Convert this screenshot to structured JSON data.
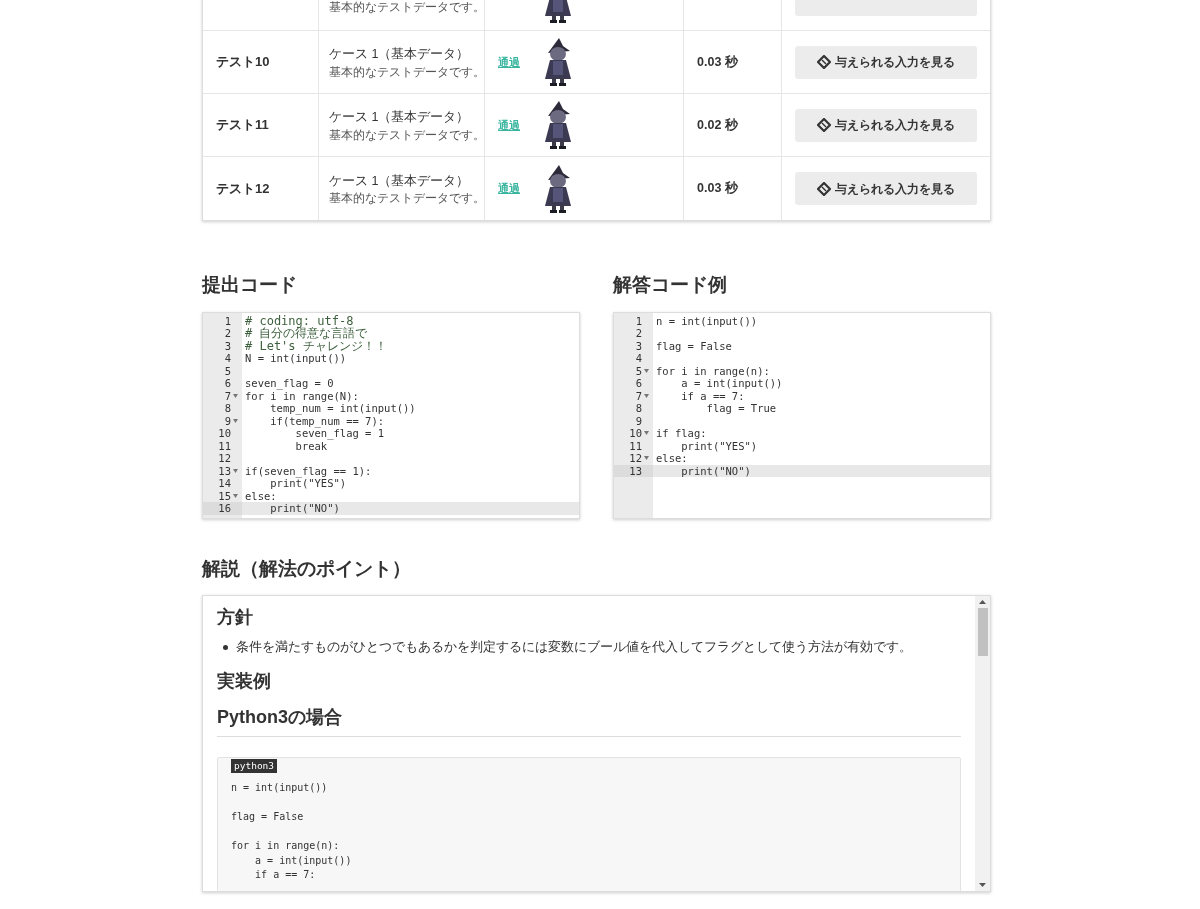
{
  "test_table": {
    "rows": [
      {
        "description": "基本的なテストデータです。"
      },
      {
        "name": "テスト10",
        "case": "ケース 1（基本データ）",
        "description": "基本的なテストデータです。",
        "result": "通過",
        "time": "0.03 秒",
        "button": "与えられる入力を見る"
      },
      {
        "name": "テスト11",
        "case": "ケース 1（基本データ）",
        "description": "基本的なテストデータです。",
        "result": "通過",
        "time": "0.02 秒",
        "button": "与えられる入力を見る"
      },
      {
        "name": "テスト12",
        "case": "ケース 1（基本データ）",
        "description": "基本的なテストデータです。",
        "result": "通過",
        "time": "0.03 秒",
        "button": "与えられる入力を見る"
      }
    ]
  },
  "editors": [
    {
      "title": "提出コード",
      "lines": [
        {
          "no": "1",
          "text": "# coding: utf-8",
          "kind": "comment",
          "fold": false,
          "active": false
        },
        {
          "no": "2",
          "text": "# 自分の得意な言語で",
          "kind": "comment",
          "fold": false,
          "active": false
        },
        {
          "no": "3",
          "text": "# Let's チャレンジ！！",
          "kind": "comment",
          "fold": false,
          "active": false
        },
        {
          "no": "4",
          "text": "N = int(input())",
          "kind": "code",
          "fold": false,
          "active": false
        },
        {
          "no": "5",
          "kind": "code",
          "fold": false,
          "active": false
        },
        {
          "no": "6",
          "text": "seven_flag = 0",
          "kind": "code",
          "fold": false,
          "active": false
        },
        {
          "no": "7",
          "text": "for i in range(N):",
          "kind": "code",
          "fold": true,
          "active": false
        },
        {
          "no": "8",
          "text": "    temp_num = int(input())",
          "kind": "code",
          "fold": false,
          "active": false
        },
        {
          "no": "9",
          "text": "    if(temp_num == 7):",
          "kind": "code",
          "fold": true,
          "active": false
        },
        {
          "no": "10",
          "text": "        seven_flag = 1",
          "kind": "code",
          "fold": false,
          "active": false
        },
        {
          "no": "11",
          "text": "        break",
          "kind": "code",
          "fold": false,
          "active": false
        },
        {
          "no": "12",
          "kind": "code",
          "fold": false,
          "active": false
        },
        {
          "no": "13",
          "text": "if(seven_flag == 1):",
          "kind": "code",
          "fold": true,
          "active": false
        },
        {
          "no": "14",
          "text": "    print(\"YES\")",
          "kind": "code",
          "fold": false,
          "active": false
        },
        {
          "no": "15",
          "text": "else:",
          "kind": "code",
          "fold": true,
          "active": false
        },
        {
          "no": "16",
          "text": "    print(\"NO\")",
          "kind": "code",
          "fold": false,
          "active": true
        }
      ]
    },
    {
      "title": "解答コード例",
      "lines": [
        {
          "no": "1",
          "text": "n = int(input())",
          "kind": "code",
          "fold": false,
          "active": false
        },
        {
          "no": "2",
          "kind": "code",
          "fold": false,
          "active": false
        },
        {
          "no": "3",
          "text": "flag = False",
          "kind": "code",
          "fold": false,
          "active": false
        },
        {
          "no": "4",
          "kind": "code",
          "fold": false,
          "active": false
        },
        {
          "no": "5",
          "text": "for i in range(n):",
          "kind": "code",
          "fold": true,
          "active": false
        },
        {
          "no": "6",
          "text": "    a = int(input())",
          "kind": "code",
          "fold": false,
          "active": false
        },
        {
          "no": "7",
          "text": "    if a == 7:",
          "kind": "code",
          "fold": true,
          "active": false
        },
        {
          "no": "8",
          "text": "        flag = True",
          "kind": "code",
          "fold": false,
          "active": false
        },
        {
          "no": "9",
          "kind": "code",
          "fold": false,
          "active": false
        },
        {
          "no": "10",
          "text": "if flag:",
          "kind": "code",
          "fold": true,
          "active": false
        },
        {
          "no": "11",
          "text": "    print(\"YES\")",
          "kind": "code",
          "fold": false,
          "active": false
        },
        {
          "no": "12",
          "text": "else:",
          "kind": "code",
          "fold": true,
          "active": false
        },
        {
          "no": "13",
          "text": "    print(\"NO\")",
          "kind": "code",
          "fold": false,
          "active": true
        }
      ]
    }
  ],
  "explanation": {
    "title": "解説（解法のポイント）",
    "heading_1": "方針",
    "bullets": [
      "条件を満たすものがひとつでもあるかを判定するには変数にブール値を代入してフラグとして使う方法が有効です。"
    ],
    "heading_2": "実装例",
    "heading_3": "Python3の場合",
    "code_label": "python3",
    "code_lines": [
      {
        "kind": "code",
        "text": "n = int(input())"
      },
      {
        "kind": "blank"
      },
      {
        "kind": "code",
        "text": "flag = False"
      },
      {
        "kind": "blank"
      },
      {
        "kind": "code",
        "text": "for i in range(n):"
      },
      {
        "kind": "code",
        "text": "    a = int(input())"
      },
      {
        "kind": "code",
        "text": "    if a == 7:"
      }
    ]
  }
}
